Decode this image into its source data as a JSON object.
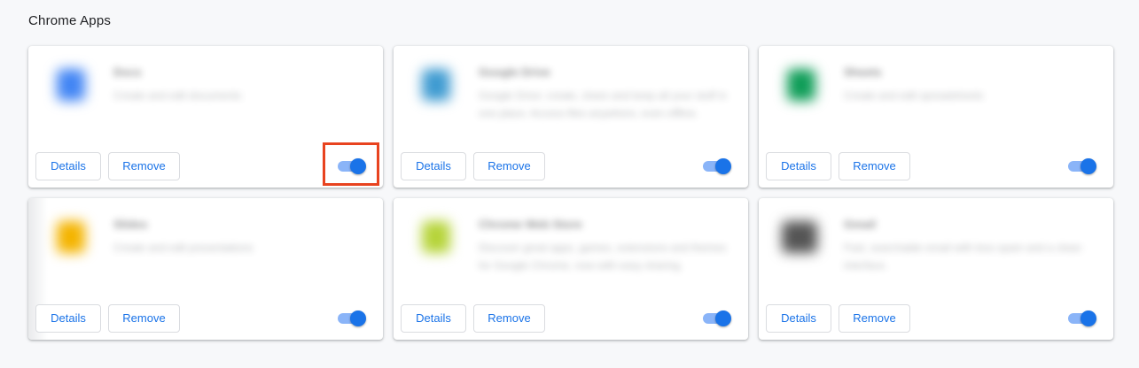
{
  "section": {
    "title": "Chrome Apps"
  },
  "apps": [
    {
      "name": "Docs",
      "description": "Create and edit documents",
      "icon": "docs-app-icon",
      "icon_color": "#4285f4",
      "details_label": "Details",
      "remove_label": "Remove",
      "enabled": true
    },
    {
      "name": "Google Drive",
      "description": "Google Drive: create, share and keep all your stuff in one place. Access files anywhere, even offline.",
      "icon": "drive-app-icon",
      "icon_color": "#3f9bd1",
      "details_label": "Details",
      "remove_label": "Remove",
      "enabled": true
    },
    {
      "name": "Sheets",
      "description": "Create and edit spreadsheets",
      "icon": "sheets-app-icon",
      "icon_color": "#0f9d58",
      "details_label": "Details",
      "remove_label": "Remove",
      "enabled": true
    },
    {
      "name": "Slides",
      "description": "Create and edit presentations",
      "icon": "slides-app-icon",
      "icon_color": "#f4b400",
      "details_label": "Details",
      "remove_label": "Remove",
      "enabled": true
    },
    {
      "name": "Chrome Web Store",
      "description": "Discover great apps, games, extensions and themes for Google Chrome, now with easy sharing.",
      "icon": "webstore-app-icon",
      "icon_color": "#b6d43a",
      "details_label": "Details",
      "remove_label": "Remove",
      "enabled": true
    },
    {
      "name": "Gmail",
      "description": "Fast, searchable email with less spam and a clean interface.",
      "icon": "gmail-app-icon",
      "icon_color": "#555555",
      "details_label": "Details",
      "remove_label": "Remove",
      "enabled": true
    }
  ],
  "colors": {
    "accent": "#1a73e8",
    "toggle_track": "#8ab4f8",
    "highlight": "#e8431f",
    "background": "#f7f8fa"
  }
}
